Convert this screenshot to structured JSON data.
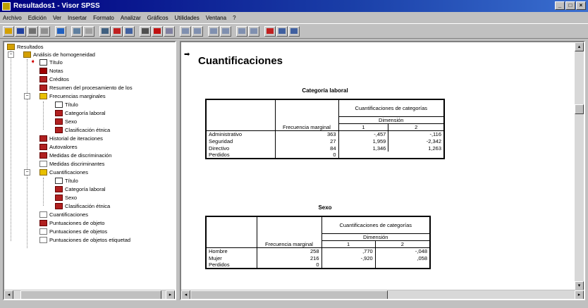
{
  "window": {
    "title": "Resultados1 - Visor SPSS",
    "buttons": [
      "_",
      "□",
      "×"
    ]
  },
  "menu": [
    "Archivo",
    "Edición",
    "Ver",
    "Insertar",
    "Formato",
    "Analizar",
    "Gráficos",
    "Utilidades",
    "Ventana",
    "?"
  ],
  "toolbar_icons": [
    "open-icon",
    "save-icon",
    "print-icon",
    "print-preview-icon",
    "export-icon",
    "dialog-recall-icon",
    "undo-icon",
    "goto-chart-icon",
    "goto-data-icon",
    "variables-icon",
    "find-icon",
    "insert-case-icon",
    "insert-variable-icon",
    "split-file-icon",
    "weight-cases-icon",
    "select-cases-icon",
    "value-labels-icon",
    "use-sets-icon",
    "show-all-icon",
    "designate-window-icon",
    "help-icon",
    "pivot-icon"
  ],
  "tree": {
    "root": "Resultados",
    "analysis": "Análisis de homogeneidad",
    "items": [
      "Título",
      "Notas",
      "Créditos",
      "Resumen del procesamiento de los",
      "Frecuencias marginales",
      "Título",
      "Categoría laboral",
      "Sexo",
      "Clasificación étnica",
      "Historial de iteraciones",
      "Autovalores",
      "Medidas de discriminación",
      "Medidas discriminantes",
      "Cuantificaciones",
      "Título",
      "Categoría laboral",
      "Sexo",
      "Clasificación étnica",
      "Cuantificaciones",
      "Puntuaciones de objeto",
      "Puntuaciones de objetos",
      "Puntuaciones de objetos etiquetad"
    ]
  },
  "output": {
    "heading": "Cuantificaciones",
    "table1": {
      "title": "Categoría laboral",
      "hdr_freq": "Frecuencia marginal",
      "hdr_quant": "Cuantificaciones de categorías",
      "hdr_dim": "Dimensión",
      "dim1": "1",
      "dim2": "2",
      "rows": [
        {
          "label": "Administrativo",
          "freq": "363",
          "d1": "-,457",
          "d2": "-,116"
        },
        {
          "label": "Seguridad",
          "freq": "27",
          "d1": "1,959",
          "d2": "-2,342"
        },
        {
          "label": "Directivo",
          "freq": "84",
          "d1": "1,346",
          "d2": "1,263"
        },
        {
          "label": "Perdidos",
          "freq": "0",
          "d1": "",
          "d2": ""
        }
      ]
    },
    "table2": {
      "title": "Sexo",
      "hdr_freq": "Frecuencia marginal",
      "hdr_quant": "Cuantificaciones de categorías",
      "hdr_dim": "Dimensión",
      "dim1": "1",
      "dim2": "2",
      "rows": [
        {
          "label": "Hombre",
          "freq": "258",
          "d1": ",770",
          "d2": "-,048"
        },
        {
          "label": "Mujer",
          "freq": "216",
          "d1": "-,920",
          "d2": ",058"
        },
        {
          "label": "Perdidos",
          "freq": "0",
          "d1": "",
          "d2": ""
        }
      ]
    }
  }
}
